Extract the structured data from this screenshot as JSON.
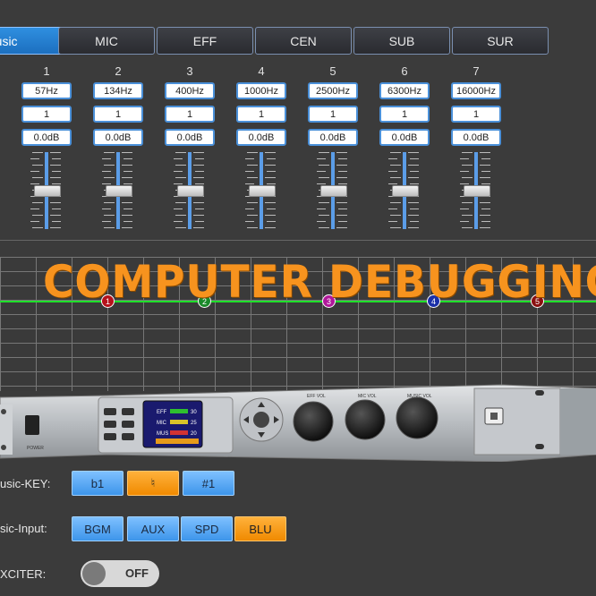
{
  "tabs": [
    {
      "label": "Music",
      "active": true
    },
    {
      "label": "MIC"
    },
    {
      "label": "EFF"
    },
    {
      "label": "CEN"
    },
    {
      "label": "SUB"
    },
    {
      "label": "SUR"
    }
  ],
  "eq_bands": [
    {
      "num": "1",
      "freq": "57Hz",
      "q": "1",
      "gain": "0.0dB"
    },
    {
      "num": "2",
      "freq": "134Hz",
      "q": "1",
      "gain": "0.0dB"
    },
    {
      "num": "3",
      "freq": "400Hz",
      "q": "1",
      "gain": "0.0dB"
    },
    {
      "num": "4",
      "freq": "1000Hz",
      "q": "1",
      "gain": "0.0dB"
    },
    {
      "num": "5",
      "freq": "2500Hz",
      "q": "1",
      "gain": "0.0dB"
    },
    {
      "num": "6",
      "freq": "6300Hz",
      "q": "1",
      "gain": "0.0dB"
    },
    {
      "num": "7",
      "freq": "16000Hz",
      "q": "1",
      "gain": "0.0dB"
    }
  ],
  "graph": {
    "markers": [
      {
        "label": "1",
        "color": "#b5121b"
      },
      {
        "label": "2",
        "color": "#1a8a2a"
      },
      {
        "label": "3",
        "color": "#b0189a"
      },
      {
        "label": "4",
        "color": "#1a2fa8"
      },
      {
        "label": "5",
        "color": "#8a1010"
      }
    ]
  },
  "watermark": "COMPUTER DEBUGGING",
  "device": {
    "screen": [
      {
        "label": "EFF",
        "value": "30"
      },
      {
        "label": "MIC",
        "value": "25"
      },
      {
        "label": "MUS",
        "value": "20"
      }
    ],
    "knob_labels": [
      "EFF VOL",
      "MIC VOL",
      "MUSIC VOL"
    ],
    "power_label": "POWER"
  },
  "music_key": {
    "label": "usic-KEY:",
    "options": [
      "b1",
      "♮",
      "#1"
    ],
    "selected": "♮"
  },
  "music_input": {
    "label": "sic-Input:",
    "options": [
      "BGM",
      "AUX",
      "SPD",
      "BLU"
    ],
    "selected": "BLU"
  },
  "exciter": {
    "label": "XCITER:",
    "state": "OFF"
  }
}
